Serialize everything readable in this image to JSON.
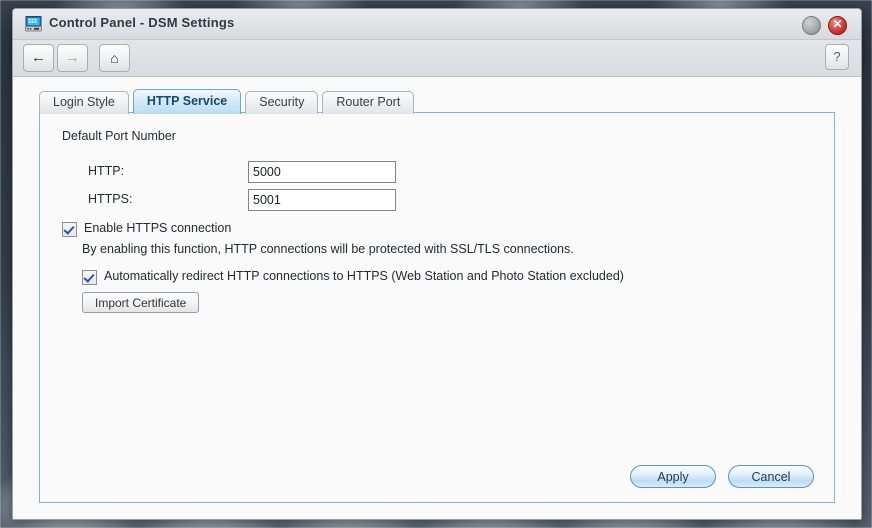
{
  "window": {
    "title": "Control Panel - DSM Settings",
    "icon": "control-panel-icon",
    "minimize_label": "",
    "close_label": "✕"
  },
  "toolbar": {
    "back_icon": "←",
    "forward_icon": "→",
    "home_icon": "⌂",
    "help_label": "?"
  },
  "tabs": [
    {
      "label": "Login Style",
      "active": false
    },
    {
      "label": "HTTP Service",
      "active": true
    },
    {
      "label": "Security",
      "active": false
    },
    {
      "label": "Router Port",
      "active": false
    }
  ],
  "main": {
    "section_title": "Default Port Number",
    "http": {
      "label": "HTTP:",
      "value": "5000"
    },
    "https": {
      "label": "HTTPS:",
      "value": "5001"
    },
    "enable_https": {
      "label": "Enable HTTPS connection",
      "checked": true
    },
    "https_description": "By enabling this function, HTTP connections will be protected with SSL/TLS connections.",
    "auto_redirect": {
      "label": "Automatically redirect HTTP connections to HTTPS (Web Station and Photo Station excluded)",
      "checked": true
    },
    "import_certificate_label": "Import Certificate"
  },
  "footer": {
    "apply_label": "Apply",
    "cancel_label": "Cancel"
  },
  "colors": {
    "accent": "#83b4d4",
    "active_tab_text": "#19486e",
    "close_button": "#cf3d35"
  }
}
